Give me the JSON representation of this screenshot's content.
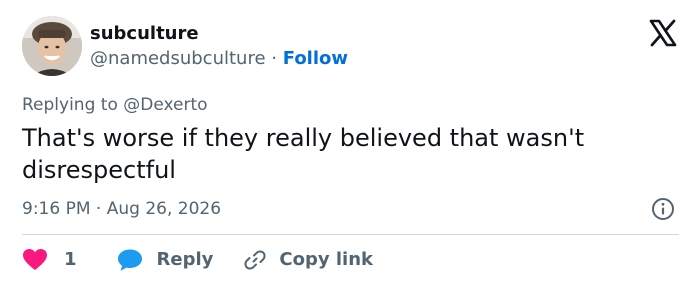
{
  "author": {
    "name": "subculture",
    "handle": "@namedsubculture",
    "separator": "·",
    "follow_label": "Follow"
  },
  "reply_context": {
    "prefix": "Replying to",
    "mention": "@Dexerto"
  },
  "tweet": {
    "text": "That's worse if they really believed that wasn't disrespectful",
    "time": "9:16 PM",
    "separator": "·",
    "date": "Aug 26, 2026"
  },
  "actions": {
    "like_count": "1",
    "reply_label": "Reply",
    "copy_link_label": "Copy link"
  },
  "icons": {
    "platform": "x-logo-icon",
    "info": "info-icon",
    "like": "heart-icon",
    "reply": "speech-bubble-icon",
    "copy": "link-icon"
  },
  "colors": {
    "like": "#f91880",
    "reply": "#1d9bf0",
    "follow": "#006fd6",
    "secondary_text": "#536471",
    "primary_text": "#0f1419"
  }
}
